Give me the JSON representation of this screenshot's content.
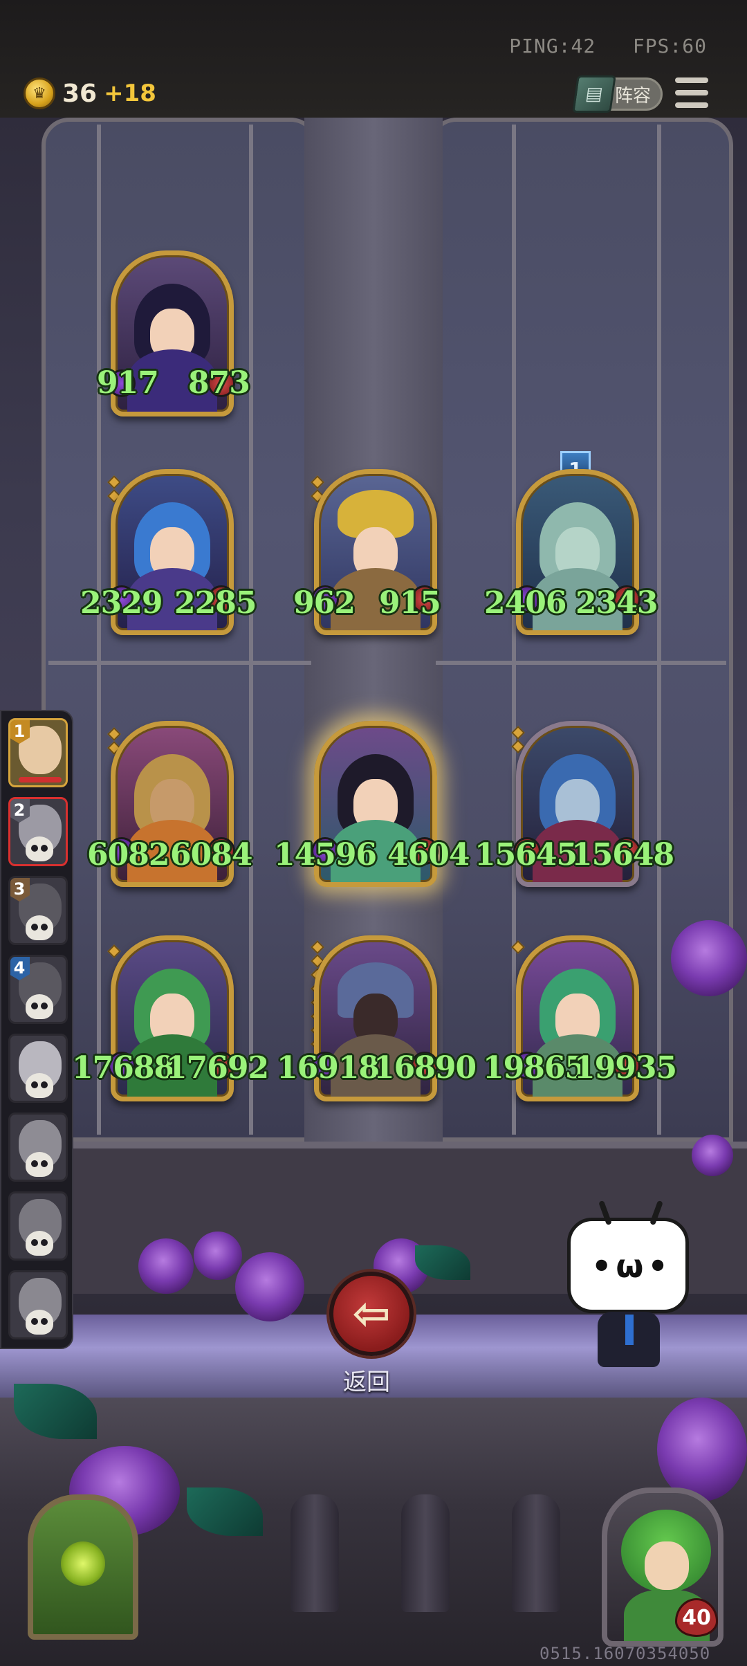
{
  "hud": {
    "ping_label": "PING:42",
    "fps_label": "FPS:60",
    "gold": "36",
    "gold_income": "+18",
    "lineup_label": "阵容",
    "coin_icon": "crown-coin-icon",
    "menu_icon": "hamburger-menu-icon"
  },
  "board": {
    "row1": [
      {
        "name": "dark-sorceress",
        "atk": "917",
        "hp": "873"
      }
    ],
    "row2": [
      {
        "name": "blue-haired-rogue",
        "atk": "2329",
        "hp": "2285"
      },
      {
        "name": "bearded-king",
        "atk": "962",
        "hp": "915"
      },
      {
        "name": "ghost-unicorn",
        "atk": "2406",
        "hp": "2343",
        "tier": "1"
      }
    ],
    "row3": [
      {
        "name": "flower-hat-girl",
        "atk": "6082",
        "hp": "6084"
      },
      {
        "name": "lotus-princess",
        "atk": "14596",
        "hp": "4604",
        "selected": true
      },
      {
        "name": "dark-elf-queen",
        "atk": "15645",
        "hp": "15648"
      }
    ],
    "row4": [
      {
        "name": "leaf-dryad",
        "atk": "17688",
        "hp": "17692"
      },
      {
        "name": "mushroom-creature",
        "atk": "16918",
        "hp": "16890"
      },
      {
        "name": "fairy-maiden",
        "atk": "19865",
        "hp": "19935"
      }
    ]
  },
  "sidebar": {
    "slots": [
      {
        "rank": "1",
        "state": "active"
      },
      {
        "rank": "2",
        "state": "eliminated"
      },
      {
        "rank": "3",
        "state": "eliminated"
      },
      {
        "rank": "4",
        "state": "eliminated"
      },
      {
        "rank": "",
        "state": "eliminated"
      },
      {
        "rank": "",
        "state": "eliminated"
      },
      {
        "rank": "",
        "state": "eliminated"
      },
      {
        "rank": "",
        "state": "eliminated"
      }
    ]
  },
  "actions": {
    "back_label": "返回",
    "back_icon": "left-arrow-icon"
  },
  "player": {
    "health": "40"
  },
  "footer": {
    "build_id": "0515.16070354050"
  },
  "colors": {
    "stat_green": "#9af27a",
    "card_gold": "#c69a3c",
    "back_red": "#a82a2a",
    "gold_income": "#f3c63b"
  }
}
